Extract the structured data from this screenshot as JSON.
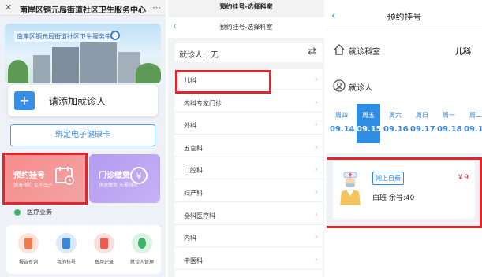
{
  "panel1": {
    "title": "南岸区铜元局街道社区卫生服务中心",
    "banner_text": "南岸区铜元局街道社区卫生服务中心",
    "add_patient": "请添加就诊人",
    "bind_card": "绑定电子健康卡",
    "tiles": [
      {
        "title": "预约挂号",
        "sub": "快速预约 足不出户"
      },
      {
        "title": "门诊缴费",
        "sub": "快速缴费 无需排队"
      }
    ],
    "section_title": "医疗业务",
    "grid_items": [
      {
        "label": "报告查询",
        "icon": "report-icon",
        "color": "#f07a4e"
      },
      {
        "label": "我的挂号",
        "icon": "registration-icon",
        "color": "#3a86d8"
      },
      {
        "label": "费用记录",
        "icon": "bill-icon",
        "color": "#f05a4e"
      },
      {
        "label": "就诊人管理",
        "icon": "patient-icon",
        "color": "#3fb26b"
      }
    ]
  },
  "panel2": {
    "title": "预约挂号-选择科室",
    "nav_title": "预约挂号-选择科室",
    "visitor_label": "就诊人:",
    "visitor_value": "无",
    "departments": [
      "儿科",
      "内科专家门诊",
      "外科",
      "五官科",
      "口腔科",
      "妇产科",
      "全科医疗科",
      "内科",
      "中医科"
    ]
  },
  "panel3": {
    "title": "预约挂号",
    "dept_label": "就诊科室",
    "dept_value": "儿科",
    "patient_label": "就诊人",
    "days": [
      {
        "weekday": "周四",
        "date": "09.14"
      },
      {
        "weekday": "周五",
        "date": "09.15"
      },
      {
        "weekday": "周六",
        "date": "09.16"
      },
      {
        "weekday": "周日",
        "date": "09.17"
      },
      {
        "weekday": "周一",
        "date": "09.18"
      },
      {
        "weekday": "周二",
        "date": "09.19"
      }
    ],
    "selected_day": 1,
    "doctor": {
      "tag": "网上自费",
      "price": "￥9",
      "info": "白班 余号:40"
    }
  },
  "colors": {
    "accent": "#2f8de4",
    "highlight": "#e0262c"
  }
}
